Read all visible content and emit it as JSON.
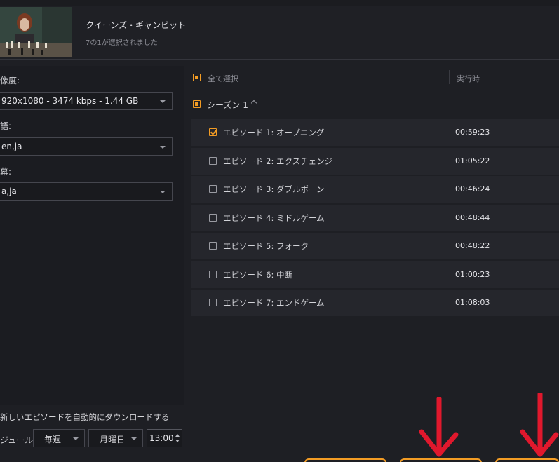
{
  "header": {
    "title": "クイーンズ・ギャンビット",
    "subtitle": "7の1が選択されました"
  },
  "settings": {
    "quality_label": "像度:",
    "quality_value": "920x1080 - 3474 kbps - 1.44 GB",
    "audio_label": "語:",
    "audio_value": "en,ja",
    "subtitle_label": "幕:",
    "subtitle_value": "a,ja"
  },
  "list": {
    "select_all": "全て選択",
    "runtime_header": "実行時",
    "season": "シーズン 1",
    "episodes": [
      {
        "label": "エピソード 1: オープニング",
        "duration": "00:59:23",
        "checked": true
      },
      {
        "label": "エピソード 2: エクスチェンジ",
        "duration": "01:05:22",
        "checked": false
      },
      {
        "label": "エピソード 3: ダブルポーン",
        "duration": "00:46:24",
        "checked": false
      },
      {
        "label": "エピソード 4: ミドルゲーム",
        "duration": "00:48:44",
        "checked": false
      },
      {
        "label": "エピソード 5: フォーク",
        "duration": "00:48:22",
        "checked": false
      },
      {
        "label": "エピソード 6: 中断",
        "duration": "01:00:23",
        "checked": false
      },
      {
        "label": "エピソード 7: エンドゲーム",
        "duration": "01:08:03",
        "checked": false
      }
    ]
  },
  "schedule": {
    "auto_download": "新しいエピソードを自動的にダウンロードする",
    "label": "ジュール:",
    "frequency": "毎週",
    "day": "月曜日",
    "time": "13:00"
  },
  "colors": {
    "accent": "#f39c24",
    "arrow": "#e0182d",
    "background": "#1e1f24"
  }
}
